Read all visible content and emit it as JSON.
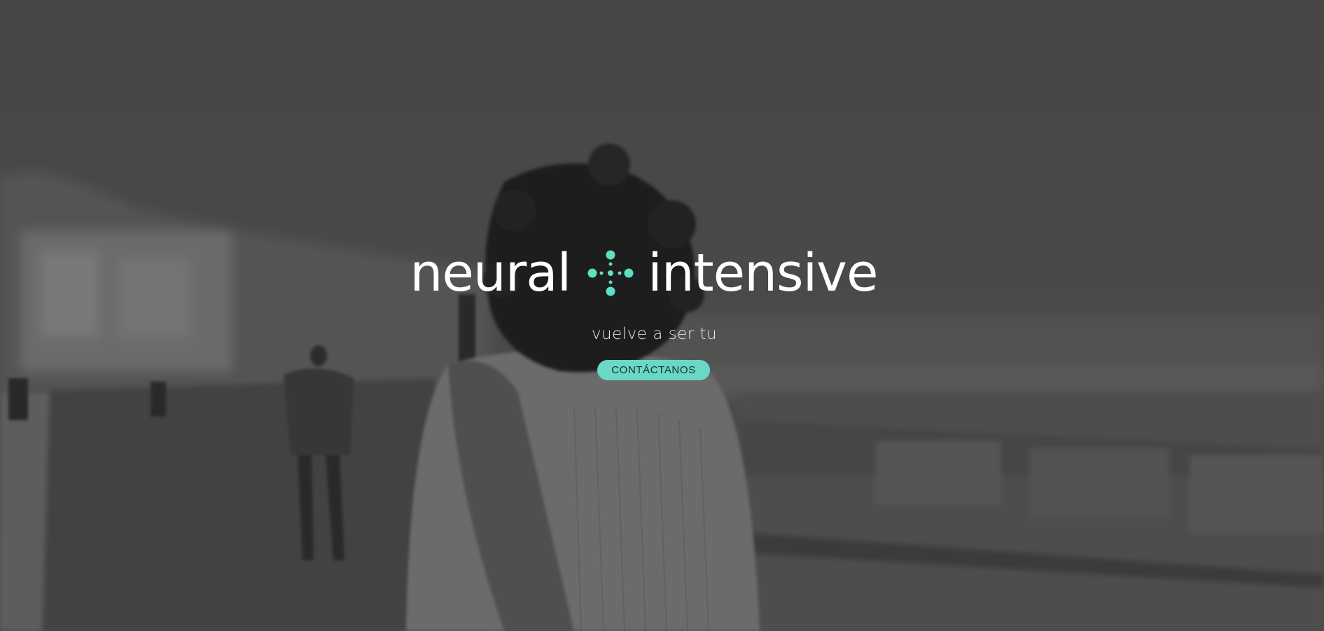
{
  "hero": {
    "logo": {
      "word_left": "neural",
      "word_right": "intensive",
      "mark_color": "#5ee0c2"
    },
    "tagline": "vuelve a ser tu",
    "cta_label": "CONTÁCTANOS",
    "accent_color": "#6ad8c6",
    "background": "grayscale video still of a woman with curly hair walking along a seaside promenade"
  }
}
